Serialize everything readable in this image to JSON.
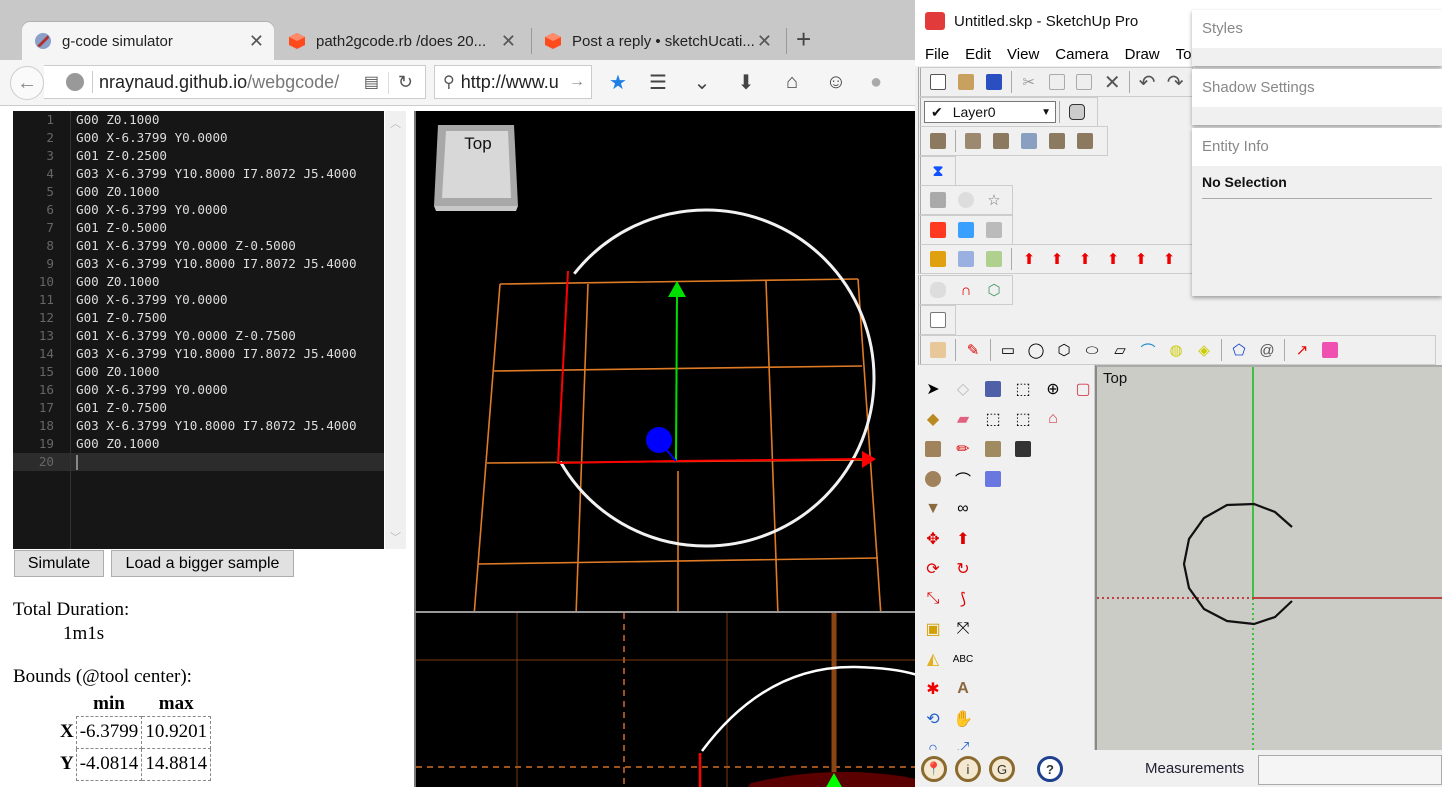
{
  "browser": {
    "tabs": [
      {
        "label": "g-code simulator",
        "icon": "globe-rocket-icon",
        "active": true
      },
      {
        "label": "path2gcode.rb /does 20...",
        "icon": "sketchup-cube-icon",
        "active": false
      },
      {
        "label": "Post a reply • sketchUcati...",
        "icon": "sketchup-cube-icon",
        "active": false
      }
    ],
    "close_glyph": "✕",
    "new_tab_glyph": "+",
    "back_glyph": "←",
    "url_host": "nraynaud.github.io",
    "url_path": "/webgcode/",
    "reader_glyph": "▤",
    "reload_glyph": "↻",
    "search_value": "http://www.u",
    "search_glyph": "⚲",
    "go_glyph": "→",
    "toolbar_icons": [
      {
        "name": "bookmark-star-icon",
        "glyph": "★",
        "color": "#1e7ee6"
      },
      {
        "name": "bookmarks-list-icon",
        "glyph": "☰",
        "color": "#444"
      },
      {
        "name": "pocket-icon",
        "glyph": "⌄",
        "color": "#444"
      },
      {
        "name": "download-icon",
        "glyph": "⬇",
        "color": "#444"
      },
      {
        "name": "home-icon",
        "glyph": "⌂",
        "color": "#444"
      },
      {
        "name": "chat-smiley-icon",
        "glyph": "☺",
        "color": "#444"
      },
      {
        "name": "extension-icon",
        "glyph": "●",
        "color": "#aaa"
      }
    ]
  },
  "editor": {
    "lines": [
      "G00 Z0.1000",
      "G00 X-6.3799 Y0.0000",
      "G01 Z-0.2500",
      "G03 X-6.3799 Y10.8000 I7.8072 J5.4000",
      "G00 Z0.1000",
      "G00 X-6.3799 Y0.0000",
      "G01 Z-0.5000",
      "G01 X-6.3799 Y0.0000 Z-0.5000",
      "G03 X-6.3799 Y10.8000 I7.8072 J5.4000",
      "G00 Z0.1000",
      "G00 X-6.3799 Y0.0000",
      "G01 Z-0.7500",
      "G01 X-6.3799 Y0.0000 Z-0.7500",
      "G03 X-6.3799 Y10.8000 I7.8072 J5.4000",
      "G00 Z0.1000",
      "G00 X-6.3799 Y0.0000",
      "G01 Z-0.7500",
      "G03 X-6.3799 Y10.8000 I7.8072 J5.4000",
      "G00 Z0.1000",
      ""
    ],
    "current_line": 20,
    "scroll_up": "︿",
    "scroll_down": "﹀"
  },
  "buttons": {
    "simulate": "Simulate",
    "load_sample": "Load a bigger sample"
  },
  "stats": {
    "duration_label": "Total Duration:",
    "duration_value": "1m1s",
    "bounds_label": "Bounds (@tool center):",
    "bounds_headers": [
      "min",
      "max"
    ],
    "bounds_rows": [
      {
        "axis": "X",
        "min": "-6.3799",
        "max": "10.9201"
      },
      {
        "axis": "Y",
        "min": "-4.0814",
        "max": "14.8814"
      }
    ]
  },
  "view3d": {
    "cube_label": "Top",
    "colors": {
      "grid": "#e07b25",
      "x_axis": "#ff0000",
      "y_axis": "#00e000",
      "tool": "#0000ff",
      "path": "#ffffff"
    }
  },
  "sketchup": {
    "title": "Untitled.skp - SketchUp Pro",
    "menu": [
      "File",
      "Edit",
      "View",
      "Camera",
      "Draw",
      "To"
    ],
    "layer": "Layer0",
    "trays": [
      {
        "title": "Styles"
      },
      {
        "title": "Shadow Settings"
      },
      {
        "title": "Entity Info",
        "selection": "No Selection"
      }
    ],
    "viewport_label": "Top",
    "measurements_label": "Measurements",
    "measurements_value": ""
  }
}
